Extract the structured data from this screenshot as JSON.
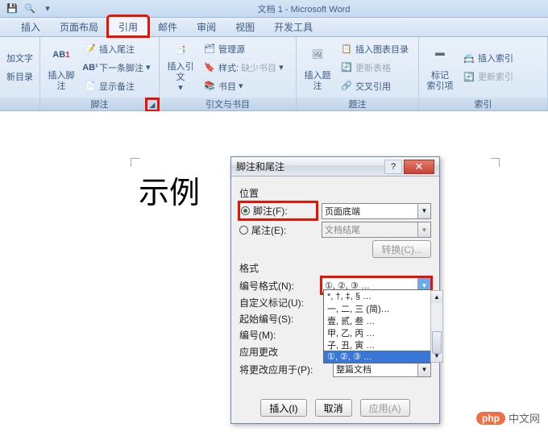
{
  "titlebar": {
    "title": "文档 1 - Microsoft Word"
  },
  "tabs": {
    "insert": "插入",
    "layout": "页面布局",
    "references": "引用",
    "mail": "邮件",
    "review": "审阅",
    "view": "视图",
    "developer": "开发工具"
  },
  "ribbon": {
    "group_toc": {
      "btn1a": "加文字",
      "btn1b": "新目录",
      "label": ""
    },
    "group_footnotes": {
      "big": "插入脚注",
      "insert_endnote": "插入尾注",
      "next_footnote": "下一条脚注",
      "show_notes": "显示备注",
      "label": "脚注",
      "ab_sup": "AB",
      "sup_1": "1"
    },
    "group_citations": {
      "big": "插入引文",
      "manage_sources": "管理源",
      "style": "样式:",
      "style_value": "缺少书目",
      "bibliography": "书目",
      "label": "引文与书目"
    },
    "group_captions": {
      "big": "插入题注",
      "tof": "插入图表目录",
      "update": "更新表格",
      "crossref": "交叉引用",
      "label": "题注"
    },
    "group_index": {
      "big": "标记\n索引项",
      "insert_index": "插入索引",
      "update_index": "更新索引",
      "label": "索引"
    }
  },
  "doc": {
    "sample": "示例"
  },
  "dialog": {
    "title": "脚注和尾注",
    "section_position": "位置",
    "footnote": "脚注(F):",
    "footnote_val": "页面底端",
    "endnote": "尾注(E):",
    "endnote_val": "文档结尾",
    "convert": "转换(C)...",
    "section_format": "格式",
    "number_format": "编号格式(N):",
    "number_format_val": "①, ②, ③ …",
    "custom_mark": "自定义标记(U):",
    "start_at": "起始编号(S):",
    "numbering": "编号(M):",
    "section_apply": "应用更改",
    "apply_to": "将更改应用于(P):",
    "apply_to_val": "整篇文档",
    "insert": "插入(I)",
    "cancel": "取消",
    "apply": "应用(A)",
    "options": [
      "*, †, ‡, § …",
      "一, 二, 三 (简)…",
      "壹, 贰, 叁 …",
      "甲, 乙, 丙 …",
      "子, 丑, 寅 …",
      "①, ②, ③ …"
    ]
  },
  "watermark": {
    "brand": "php",
    "text": "中文网"
  }
}
